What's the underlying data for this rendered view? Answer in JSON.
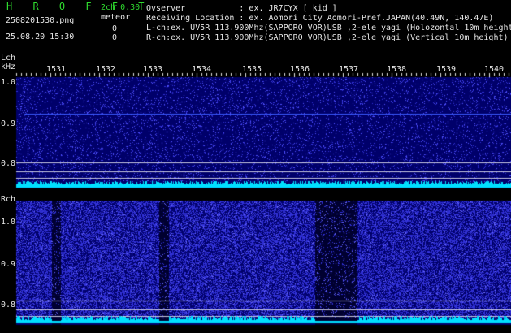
{
  "app": {
    "name_letters": "H R O F F T",
    "version": "2ch 0.30",
    "filename": "2508201530.png",
    "meteor_label": "meteor",
    "datetime": "25.08.20 15:30",
    "count_l": "0",
    "count_r": "0"
  },
  "info": {
    "observer": "Ovserver           : ex. JR7CYX [ kid ]",
    "location": "Receiving Location : ex. Aomori City Aomori-Pref.JAPAN(40.49N, 140.47E)",
    "lch": "L-ch:ex. UV5R 113.900Mhz(SAPPORO VOR)USB ,2-ele yagi (Holozontal 10m height)",
    "rch": "R-ch:ex. UV5R 113.900Mhz(SAPPORO VOR)USB ,2-ele yagi (Vertical 10m height)"
  },
  "panels": {
    "l_label": "Lch",
    "unit": "kHz",
    "r_label": "Rch",
    "time_ticks": [
      "1531",
      "1532",
      "1533",
      "1534",
      "1535",
      "1536",
      "1537",
      "1538",
      "1539",
      "1540"
    ],
    "l_freq_ticks": [
      "1.0",
      "0.9",
      "0.8"
    ],
    "r_freq_ticks": [
      "1.0",
      "0.9",
      "0.8"
    ]
  },
  "colors": {
    "noise_bg": "#00006a",
    "noise_dot": "#3232d8",
    "baseline": "#00e0ff",
    "text_green": "#2fdc2f",
    "text_white": "#e6e6e6"
  }
}
